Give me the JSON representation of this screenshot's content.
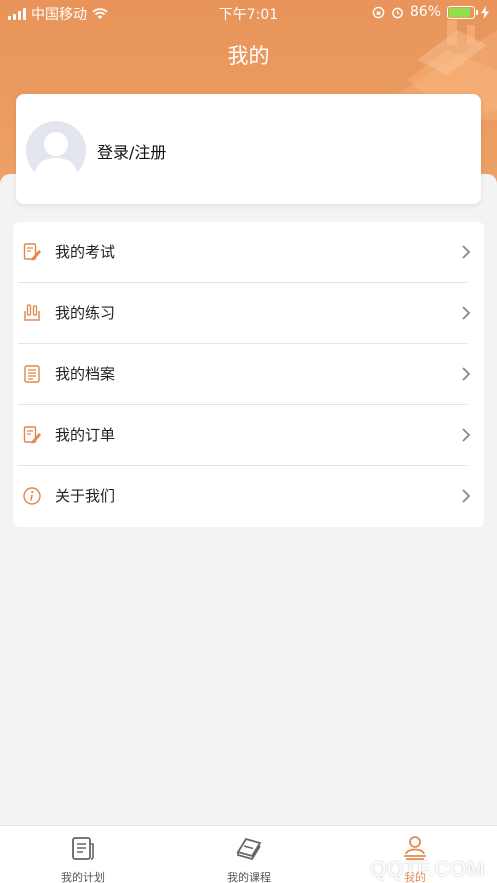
{
  "status_bar": {
    "carrier": "中国移动",
    "time": "下午7:01",
    "battery_percent": "86%",
    "battery_level": 0.86,
    "colors": {
      "battery_fill": "#8fe04a"
    }
  },
  "header": {
    "title": "我的",
    "colors": {
      "background": "#eb9c60"
    }
  },
  "user": {
    "login_label": "登录/注册"
  },
  "menu": {
    "items": [
      {
        "label": "我的考试",
        "icon": "exam-edit-icon"
      },
      {
        "label": "我的练习",
        "icon": "practice-icon"
      },
      {
        "label": "我的档案",
        "icon": "archive-icon"
      },
      {
        "label": "我的订单",
        "icon": "order-edit-icon"
      },
      {
        "label": "关于我们",
        "icon": "info-icon"
      }
    ],
    "colors": {
      "icon": "#e0874a"
    }
  },
  "tabbar": {
    "tabs": [
      {
        "label": "我的计划",
        "icon": "plan-icon",
        "active": false
      },
      {
        "label": "我的课程",
        "icon": "book-icon",
        "active": false
      },
      {
        "label": "我的",
        "icon": "profile-icon",
        "active": true
      }
    ],
    "colors": {
      "active": "#e48b4f",
      "inactive": "#555555"
    }
  },
  "watermark": "QQTF.COM"
}
